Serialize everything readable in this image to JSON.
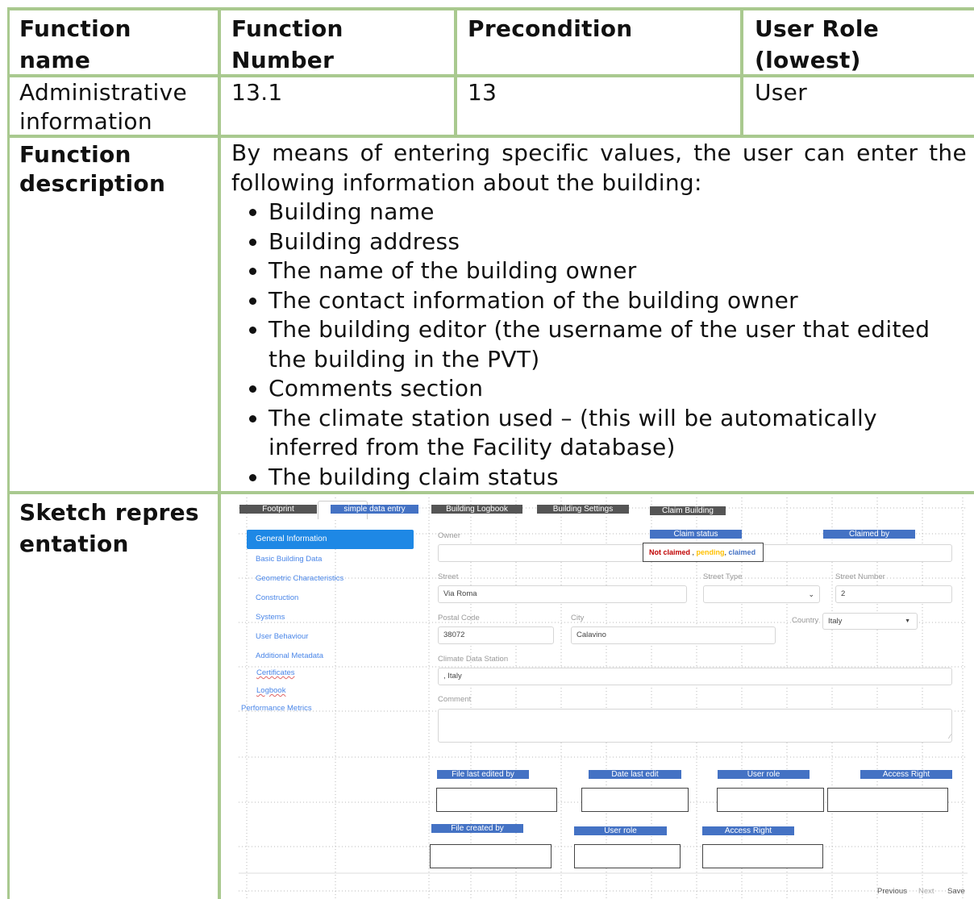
{
  "table": {
    "headers": {
      "function_name": "Function name",
      "function_number": "Function Number",
      "precondition": "Precondition",
      "user_role": "User Role (lowest)"
    },
    "row": {
      "function_name": "Administrative information",
      "function_number": "13.1",
      "precondition": "13",
      "user_role": "User"
    },
    "description_label": "Function description",
    "description_intro": "By means of entering specific values, the user can enter the following information about the building:",
    "description_items": [
      "Building name",
      "Building address",
      "The name of the building owner",
      "The contact information of the building owner",
      "The building editor (the username of the user that edited the building in the PVT)",
      "Comments section",
      "The climate station used – (this will be automatically inferred from the Facility database)",
      "The building claim status"
    ],
    "sketch_label": "Sketch representation"
  },
  "sketch": {
    "tabs": {
      "footprint": "Footprint",
      "simple_data_entry": "simple data entry",
      "building_logbook": "Building Logbook",
      "building_settings": "Building Settings",
      "claim_building": "Claim Building",
      "claim_status": "Claim status",
      "claimed_by": "Claimed by"
    },
    "sidebar": {
      "active": "General Information",
      "items": [
        "Basic Building Data",
        "Geometric Characteristics",
        "Construction",
        "Systems",
        "User Behaviour",
        "Additional Metadata",
        "Certificates",
        "Logbook",
        "Performance Metrics"
      ]
    },
    "claim_values": {
      "not_claimed": "Not claimed",
      "separator1": " , ",
      "pending": "pending",
      "separator2": ", ",
      "claimed": "claimed"
    },
    "fields": {
      "owner_label": "Owner",
      "street_label": "Street",
      "street_value": "Via Roma",
      "street_type_label": "Street Type",
      "street_number_label": "Street Number",
      "street_number_value": "2",
      "postal_code_label": "Postal Code",
      "postal_code_value": "38072",
      "city_label": "City",
      "city_value": "Calavino",
      "country_label": "Country",
      "country_value": "Italy",
      "climate_label": "Climate Data Station",
      "climate_value": ", Italy",
      "comment_label": "Comment"
    },
    "meta_labels": {
      "file_last_edited_by": "File last edited by",
      "date_last_edit": "Date last edit",
      "user_role": "User role",
      "access_right": "Access Right",
      "file_created_by": "File  created by",
      "user_role_2": "User role",
      "access_right_2": "Access Right"
    },
    "footer": {
      "previous": "Previous",
      "next": "Next",
      "save": "Save"
    },
    "colors": {
      "tab_dark": "#555555",
      "tab_blue": "#4472c4",
      "active_item": "#1e88e5",
      "not_claimed": "#c00000",
      "pending": "#ffc000",
      "claimed": "#4472c4"
    }
  }
}
